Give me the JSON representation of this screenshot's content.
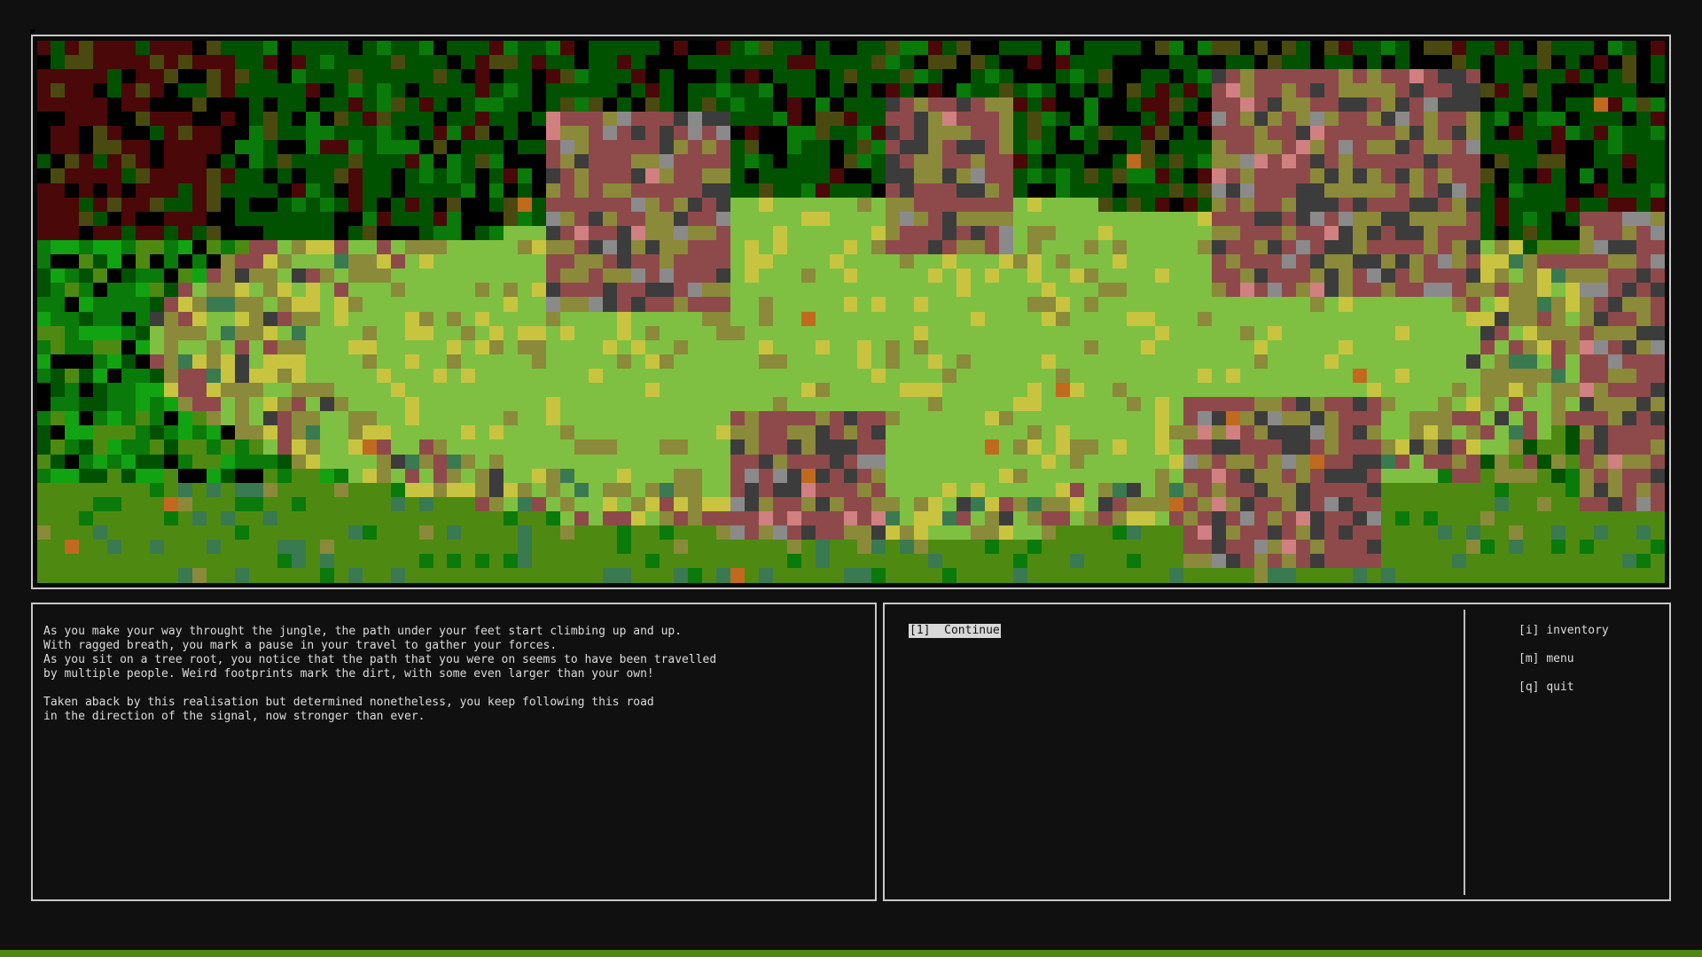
{
  "scene": {
    "palette": {
      "black": "#000000",
      "dark_green": "#005200",
      "forest_green": "#0a7a0a",
      "bright_green": "#12a312",
      "grass_green": "#4e8a12",
      "light_green": "#7fc043",
      "olive": "#8a8a3a",
      "yellow": "#c8c440",
      "maroon": "#4a0808",
      "rose_brown": "#8e4a4a",
      "pink": "#d08080",
      "dark_gray": "#3c3c3c",
      "gray": "#8a8a8a",
      "teal": "#3a7a50",
      "orange": "#c06a20",
      "dark_olive": "#4a4a10"
    }
  },
  "story": {
    "lines": [
      "As you make your way throught the jungle, the path under your feet start climbing up and up.",
      "With ragged breath, you mark a pause in your travel to gather your forces.",
      "As you sit on a tree root, you notice that the path that you were on seems to have been travelled",
      "by multiple people. Weird footprints mark the dirt, with some even larger than your own!",
      "",
      "Taken aback by this realisation but determined nonetheless, you keep following this road",
      "in the direction of the signal, now stronger than ever."
    ]
  },
  "choices": [
    {
      "key": "[1]",
      "label": "Continue"
    }
  ],
  "commands": [
    {
      "key": "[i]",
      "label": "inventory"
    },
    {
      "key": "[m]",
      "label": "menu"
    },
    {
      "key": "[q]",
      "label": "quit"
    }
  ],
  "status_bar": {
    "color": "#4f8a10"
  }
}
